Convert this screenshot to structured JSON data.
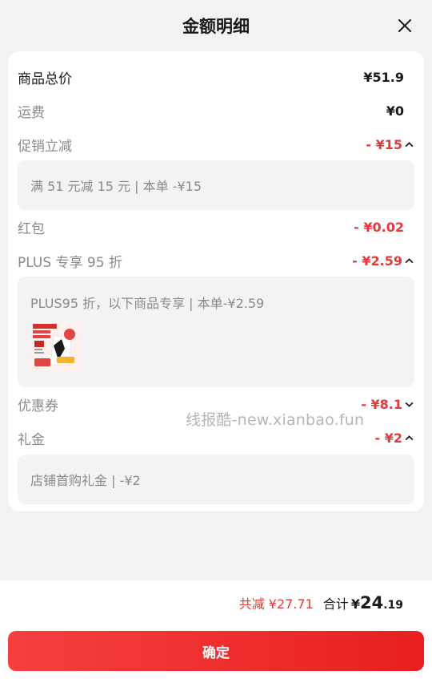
{
  "header": {
    "title": "金额明细",
    "close_icon": "close-icon"
  },
  "rows": {
    "total_price": {
      "label": "商品总价",
      "value": "¥51.9"
    },
    "shipping": {
      "label": "运费",
      "value": "¥0"
    },
    "promo": {
      "label": "促销立减",
      "value": "- ¥15",
      "detail": "满 51 元减 15 元 | 本单 -¥15"
    },
    "red_packet": {
      "label": "红包",
      "value": "- ¥0.02"
    },
    "plus": {
      "label": "PLUS 专享 95 折",
      "value": "- ¥2.59",
      "detail": "PLUS95 折，以下商品专享 | 本单-¥2.59"
    },
    "coupon": {
      "label": "优惠券",
      "value": "- ¥8.1"
    },
    "gift": {
      "label": "礼金",
      "value": "- ¥2",
      "detail": "店铺首购礼金 | -¥2"
    }
  },
  "watermark": "线报酷-new.xianbao.fun",
  "footer": {
    "saved": "共减 ¥27.71",
    "total_label": "合计",
    "total_currency": "¥",
    "total_int": "24",
    "total_dec": ".19",
    "confirm_label": "确定"
  },
  "colors": {
    "accent": "#e4393c",
    "button": "#f0302f"
  }
}
